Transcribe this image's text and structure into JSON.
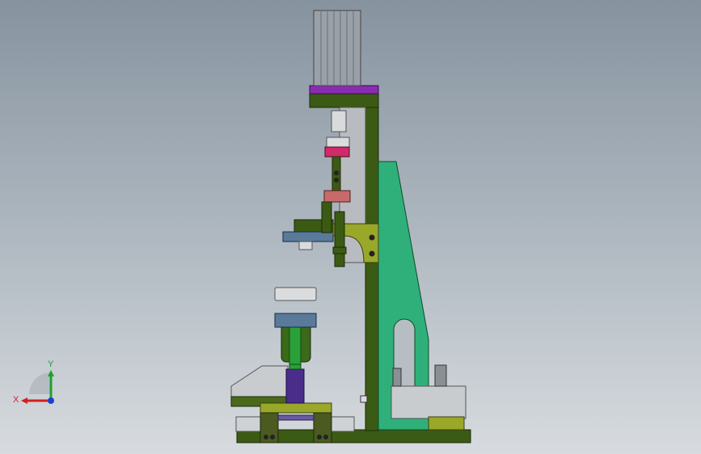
{
  "view": {
    "background_top": "#86939f",
    "background_bottom": "#d7dbdf"
  },
  "model_colors": {
    "frame": "#3b5a14",
    "gusset": "#2fb07a",
    "motor": "#9aa0a8",
    "motor_plate": "#8a2cb0",
    "magenta_block": "#d02a6a",
    "salmon_block": "#c86a6a",
    "yellow_parts": "#9aa82a",
    "blue_block": "#5a7a9a",
    "purple_rod": "#4a2c8a",
    "green_rod": "#2aa038",
    "gray_parts": "#c6c9cc"
  },
  "triad": {
    "x_label": "X",
    "y_label": "Y",
    "x_color": "#d42020",
    "y_color": "#20a030",
    "z_color": "#2040d0"
  }
}
